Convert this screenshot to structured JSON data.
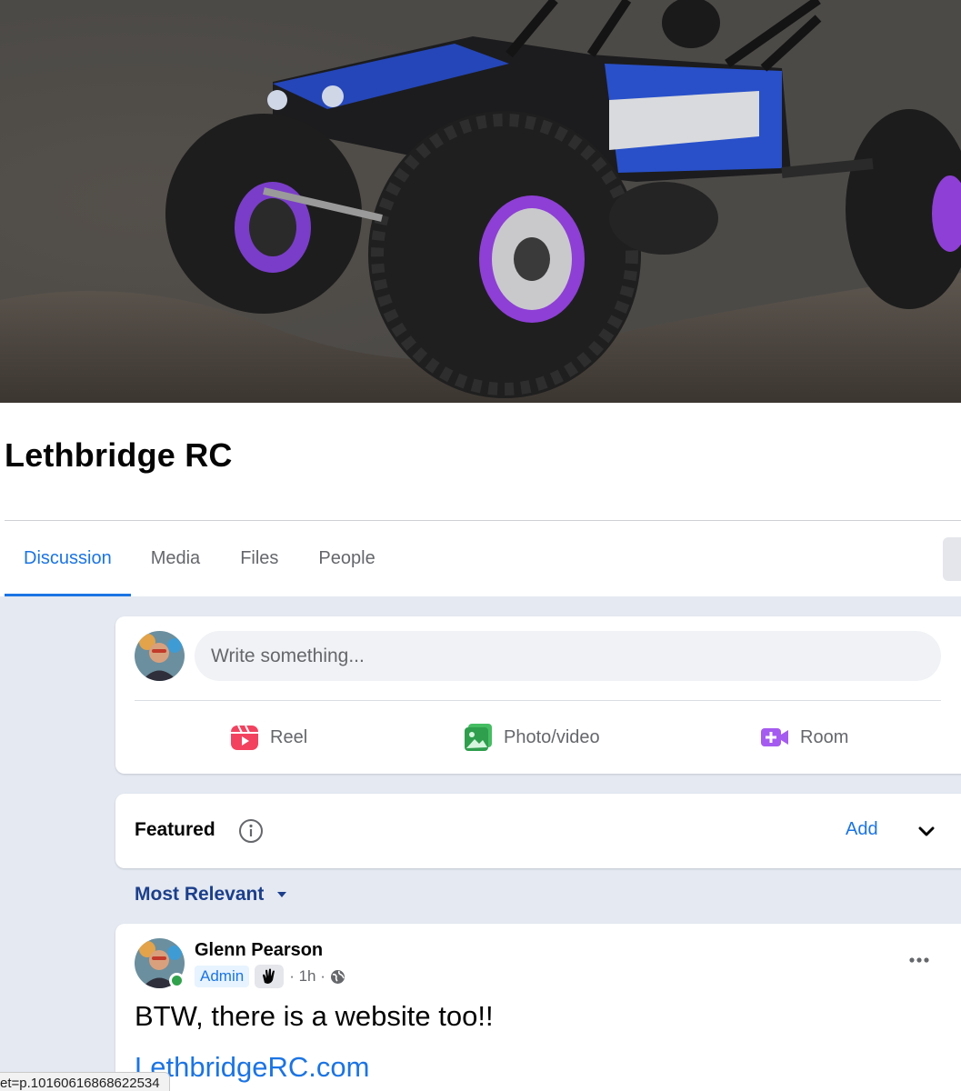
{
  "group": {
    "name": "Lethbridge RC"
  },
  "tabs": [
    {
      "label": "Discussion",
      "active": true
    },
    {
      "label": "Media"
    },
    {
      "label": "Files"
    },
    {
      "label": "People"
    }
  ],
  "composer": {
    "placeholder": "Write something...",
    "actions": [
      {
        "label": "Reel",
        "icon": "reel-icon",
        "color": "#f3425f"
      },
      {
        "label": "Photo/video",
        "icon": "photo-icon",
        "color": "#45bd62"
      },
      {
        "label": "Room",
        "icon": "video-room-icon",
        "color": "#a55bf0"
      }
    ]
  },
  "featured": {
    "label": "Featured",
    "add_label": "Add"
  },
  "sort": {
    "label": "Most Relevant"
  },
  "post": {
    "author": "Glenn Pearson",
    "badge": "Admin",
    "time": "· 1h ·",
    "text": "BTW, there is a website too!!",
    "link": "LethbridgeRC.com"
  },
  "status_bar": {
    "url": "et=p.10160616868622534"
  },
  "colors": {
    "accent": "#1b74e4",
    "feed_bg": "#e4e9f2",
    "online": "#31a24c"
  }
}
